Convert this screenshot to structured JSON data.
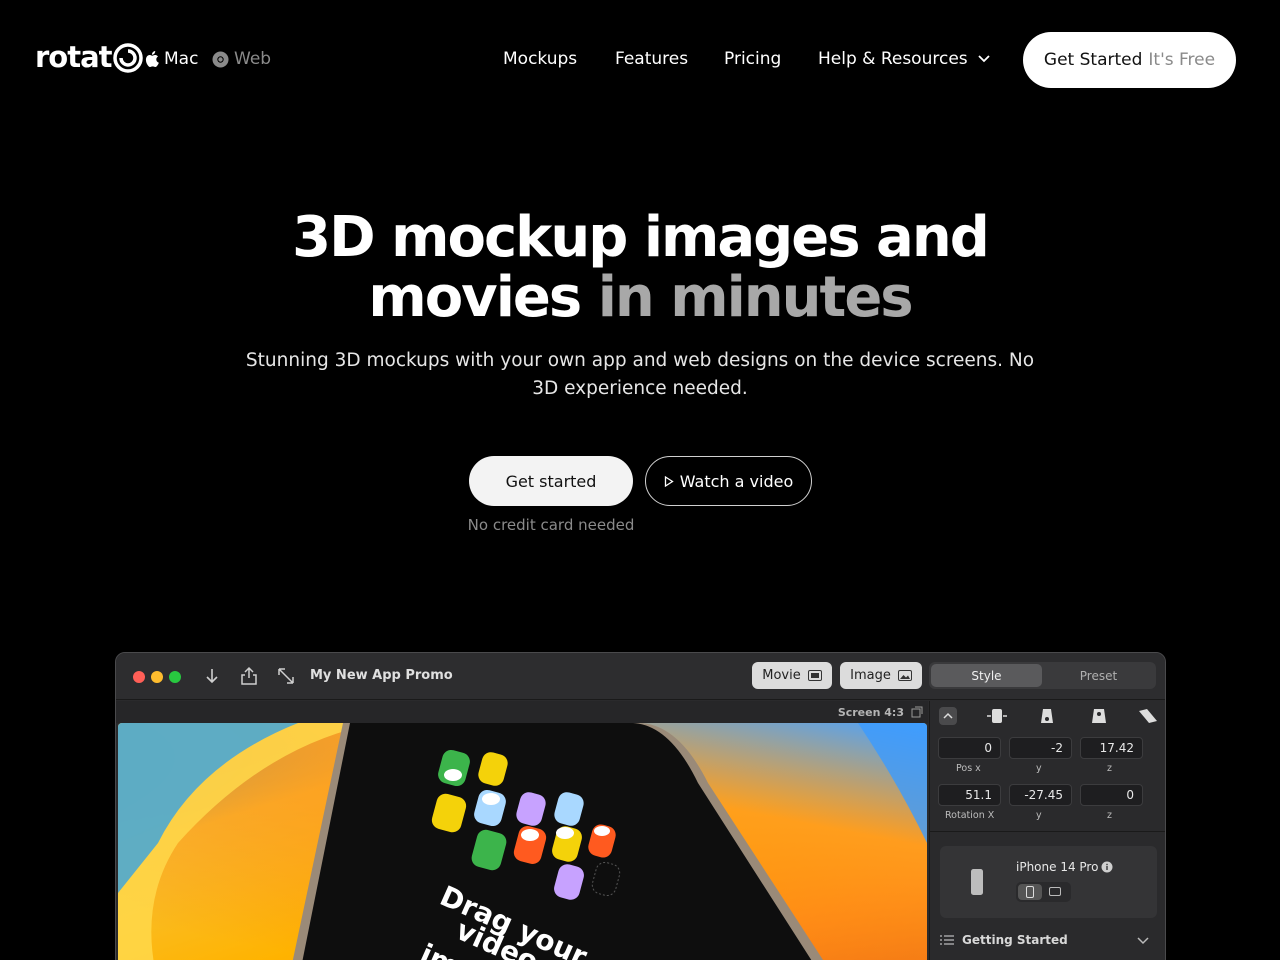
{
  "nav": {
    "logo": "rotat",
    "platforms": [
      {
        "label": "Mac",
        "icon": "apple-icon"
      },
      {
        "label": "Web",
        "icon": "chrome-icon"
      }
    ],
    "menu": [
      "Mockups",
      "Features",
      "Pricing",
      "Help & Resources"
    ],
    "cta": {
      "primary": "Get Started",
      "secondary": "It's Free"
    }
  },
  "hero": {
    "line1": "3D mockup images and",
    "line2_a": "movies",
    "line2_b": "in minutes",
    "subtitle": "Stunning 3D mockups with your own app and web designs on the device screens. No 3D experience needed.",
    "primary_button": "Get started",
    "secondary_button": "Watch a video",
    "note": "No credit card needed"
  },
  "app": {
    "title": "My New App Promo",
    "movie_label": "Movie",
    "image_label": "Image",
    "tabs": [
      "Style",
      "Preset"
    ],
    "screen_label": "Screen",
    "aspect": "4:3",
    "position": {
      "x": "0",
      "y": "-2",
      "z": "17.42",
      "label": "Pos x",
      "y_label": "y",
      "z_label": "z"
    },
    "rotation": {
      "x": "51.1",
      "y": "-27.45",
      "z": "0",
      "label": "Rotation X",
      "y_label": "y",
      "z_label": "z"
    },
    "device": "iPhone 14 Pro",
    "section": "Getting Started",
    "canvas_text": [
      "Drag your",
      "video",
      "im"
    ]
  },
  "colors": {
    "background": "#000000",
    "dim_text": "#a8a8a8",
    "muted": "#8a8a8a"
  }
}
